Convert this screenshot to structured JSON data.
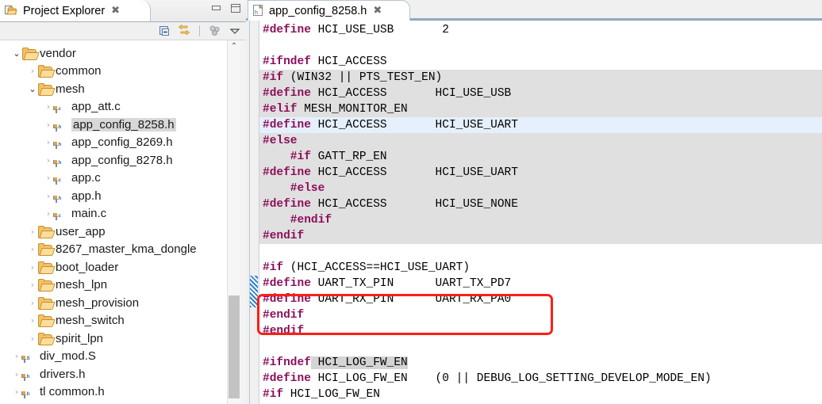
{
  "left_view": {
    "tab_title": "Project Explorer",
    "tab_close": "✖",
    "toolbar": {
      "collapse_all": "collapse-all",
      "link_with_editor": "link-with-editor",
      "view_menu": "view-menu",
      "view_chevron": "▽"
    },
    "window": {
      "minimize": "minimize",
      "maximize": "maximize"
    },
    "tree": [
      {
        "label": "vendor",
        "indent": 0,
        "arrow": "expanded",
        "arrow_glyph": "⌄",
        "icon": "folder",
        "selected": false
      },
      {
        "label": "common",
        "indent": 1,
        "arrow": "collapsed",
        "arrow_glyph": "›",
        "icon": "folder",
        "selected": false
      },
      {
        "label": "mesh",
        "indent": 1,
        "arrow": "expanded",
        "arrow_glyph": "⌄",
        "icon": "folder",
        "selected": false
      },
      {
        "label": "app_att.c",
        "indent": 2,
        "arrow": "collapsed",
        "arrow_glyph": "›",
        "icon": "file-c",
        "ext": ".c",
        "selected": false
      },
      {
        "label": "app_config_8258.h",
        "indent": 2,
        "arrow": "collapsed",
        "arrow_glyph": "›",
        "icon": "file-h",
        "ext": ".h",
        "selected": true
      },
      {
        "label": "app_config_8269.h",
        "indent": 2,
        "arrow": "collapsed",
        "arrow_glyph": "›",
        "icon": "file-h",
        "ext": ".h",
        "selected": false
      },
      {
        "label": "app_config_8278.h",
        "indent": 2,
        "arrow": "collapsed",
        "arrow_glyph": "›",
        "icon": "file-h",
        "ext": ".h",
        "selected": false
      },
      {
        "label": "app.c",
        "indent": 2,
        "arrow": "collapsed",
        "arrow_glyph": "›",
        "icon": "file-c",
        "ext": ".c",
        "selected": false
      },
      {
        "label": "app.h",
        "indent": 2,
        "arrow": "collapsed",
        "arrow_glyph": "›",
        "icon": "file-h",
        "ext": ".h",
        "selected": false
      },
      {
        "label": "main.c",
        "indent": 2,
        "arrow": "collapsed",
        "arrow_glyph": "›",
        "icon": "file-c",
        "ext": ".c",
        "selected": false
      },
      {
        "label": "user_app",
        "indent": 1,
        "arrow": "collapsed",
        "arrow_glyph": "›",
        "icon": "folder",
        "selected": false
      },
      {
        "label": "8267_master_kma_dongle",
        "indent": 1,
        "arrow": "collapsed",
        "arrow_glyph": "›",
        "icon": "folder",
        "selected": false
      },
      {
        "label": "boot_loader",
        "indent": 1,
        "arrow": "collapsed",
        "arrow_glyph": "›",
        "icon": "folder",
        "selected": false
      },
      {
        "label": "mesh_lpn",
        "indent": 1,
        "arrow": "collapsed",
        "arrow_glyph": "›",
        "icon": "folder",
        "selected": false
      },
      {
        "label": "mesh_provision",
        "indent": 1,
        "arrow": "collapsed",
        "arrow_glyph": "›",
        "icon": "folder",
        "selected": false
      },
      {
        "label": "mesh_switch",
        "indent": 1,
        "arrow": "collapsed",
        "arrow_glyph": "›",
        "icon": "folder",
        "selected": false
      },
      {
        "label": "spirit_lpn",
        "indent": 1,
        "arrow": "collapsed",
        "arrow_glyph": "›",
        "icon": "folder",
        "selected": false
      },
      {
        "label": "div_mod.S",
        "indent": 0,
        "arrow": "collapsed",
        "arrow_glyph": "›",
        "icon": "file-s",
        "ext": ".S",
        "selected": false
      },
      {
        "label": "drivers.h",
        "indent": 0,
        "arrow": "collapsed",
        "arrow_glyph": "›",
        "icon": "file-h",
        "ext": ".h",
        "selected": false
      },
      {
        "label": "tl common.h",
        "indent": 0,
        "arrow": "collapsed",
        "arrow_glyph": "›",
        "icon": "file-h",
        "ext": ".h",
        "selected": false
      }
    ]
  },
  "editor": {
    "tab_title": "app_config_8258.h",
    "tab_close": "✖",
    "tab_icon": "header-file-icon",
    "lines": [
      {
        "n": 0,
        "kw": "#define",
        "rest": " HCI_USE_USB       2"
      },
      {
        "n": 1,
        "kw": "",
        "rest": ""
      },
      {
        "n": 2,
        "kw": "#ifndef",
        "rest": " HCI_ACCESS"
      },
      {
        "n": 3,
        "kw": "#if",
        "rest": " (WIN32 || PTS_TEST_EN)"
      },
      {
        "n": 4,
        "kw": "#define",
        "rest": " HCI_ACCESS       HCI_USE_USB"
      },
      {
        "n": 5,
        "kw": "#elif",
        "rest": " MESH_MONITOR_EN"
      },
      {
        "n": 6,
        "kw": "#define",
        "rest": " HCI_ACCESS       HCI_USE_UART"
      },
      {
        "n": 7,
        "kw": "#else",
        "rest": ""
      },
      {
        "n": 8,
        "kw": "    #if",
        "rest": " GATT_RP_EN"
      },
      {
        "n": 9,
        "kw": "#define",
        "rest": " HCI_ACCESS       HCI_USE_UART"
      },
      {
        "n": 10,
        "kw": "    #else",
        "rest": ""
      },
      {
        "n": 11,
        "kw": "#define",
        "rest": " HCI_ACCESS       HCI_USE_NONE"
      },
      {
        "n": 12,
        "kw": "    #endif",
        "rest": ""
      },
      {
        "n": 13,
        "kw": "#endif",
        "rest": ""
      },
      {
        "n": 14,
        "kw": "",
        "rest": ""
      },
      {
        "n": 15,
        "kw": "#if",
        "rest": " (HCI_ACCESS==HCI_USE_UART)"
      },
      {
        "n": 16,
        "kw": "#define",
        "rest": " UART_TX_PIN      UART_TX_PD7"
      },
      {
        "n": 17,
        "kw": "#define",
        "rest": " UART_RX_PIN      UART_RX_PA0"
      },
      {
        "n": 18,
        "kw": "#endif",
        "rest": ""
      },
      {
        "n": 19,
        "kw": "#endif",
        "rest": ""
      },
      {
        "n": 20,
        "kw": "",
        "rest": ""
      },
      {
        "n": 21,
        "kw": "#ifndef",
        "rest": " HCI_LOG_FW_EN",
        "mark_text": " HCI_LOG_FW_EN"
      },
      {
        "n": 22,
        "kw": "#define",
        "rest": " HCI_LOG_FW_EN    (0 || DEBUG_LOG_SETTING_DEVELOP_MODE_EN)"
      },
      {
        "n": 23,
        "kw": "#if",
        "rest": " HCI_LOG_FW_EN"
      }
    ],
    "inactive_blocks": [
      {
        "from_line": 3,
        "to_line": 5
      },
      {
        "from_line": 7,
        "to_line": 13
      }
    ],
    "current_line": 6,
    "annotation": {
      "type": "red-rectangle",
      "color": "#fb1f16",
      "from_line": 16,
      "to_line": 17
    },
    "change_marker": {
      "from_line": 16,
      "to_line": 17,
      "color": "#2f7fd0"
    }
  }
}
